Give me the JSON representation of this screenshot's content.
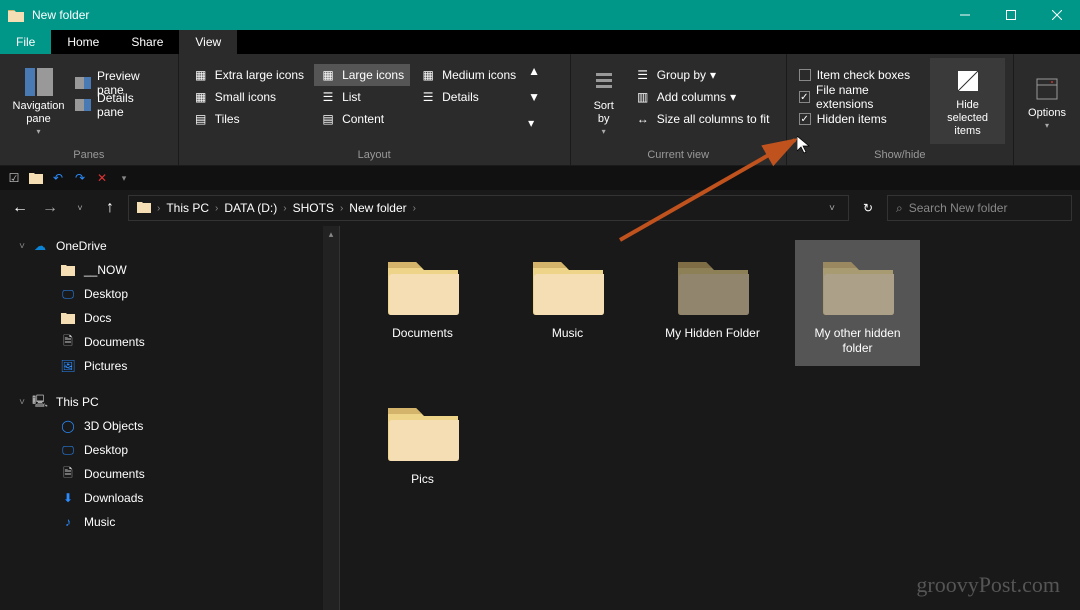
{
  "window": {
    "title": "New folder"
  },
  "tabs": {
    "file": "File",
    "home": "Home",
    "share": "Share",
    "view": "View"
  },
  "ribbon": {
    "panes": {
      "nav": "Navigation\npane",
      "preview": "Preview pane",
      "details": "Details pane",
      "label": "Panes"
    },
    "layout": {
      "xl": "Extra large icons",
      "large": "Large icons",
      "medium": "Medium icons",
      "small": "Small icons",
      "list": "List",
      "details": "Details",
      "tiles": "Tiles",
      "content": "Content",
      "label": "Layout"
    },
    "currentview": {
      "sort": "Sort\nby",
      "group": "Group by",
      "addcols": "Add columns",
      "sizeall": "Size all columns to fit",
      "label": "Current view"
    },
    "showhide": {
      "checkboxes": "Item check boxes",
      "ext": "File name extensions",
      "hidden": "Hidden items",
      "hidesel": "Hide selected\nitems",
      "label": "Show/hide"
    },
    "options": {
      "label": "Options"
    }
  },
  "breadcrumbs": [
    "This PC",
    "DATA (D:)",
    "SHOTS",
    "New folder"
  ],
  "search": {
    "placeholder": "Search New folder"
  },
  "tree": {
    "onedrive": "OneDrive",
    "now": "__NOW",
    "desktop": "Desktop",
    "docs": "Docs",
    "documents": "Documents",
    "pictures": "Pictures",
    "thispc": "This PC",
    "objects3d": "3D Objects",
    "desktop2": "Desktop",
    "documents2": "Documents",
    "downloads": "Downloads",
    "music": "Music"
  },
  "folders": [
    {
      "name": "Documents",
      "hidden": false,
      "selected": false
    },
    {
      "name": "Music",
      "hidden": false,
      "selected": false
    },
    {
      "name": "My Hidden Folder",
      "hidden": true,
      "selected": false
    },
    {
      "name": "My other hidden folder",
      "hidden": true,
      "selected": true
    },
    {
      "name": "Pics",
      "hidden": false,
      "selected": false
    }
  ],
  "watermark": "groovyPost.com"
}
